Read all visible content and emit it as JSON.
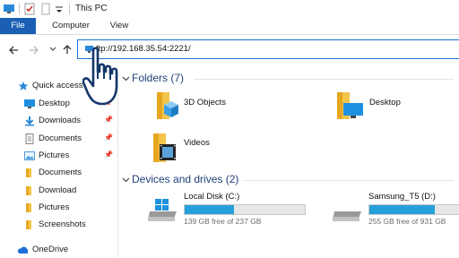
{
  "window": {
    "title": "This PC"
  },
  "ribbon": {
    "tabs": [
      "File",
      "Computer",
      "View"
    ]
  },
  "nav": {
    "back_icon": "back-arrow-icon",
    "forward_icon": "forward-arrow-icon",
    "recent_icon": "chevron-down-icon",
    "up_icon": "up-arrow-icon"
  },
  "address": {
    "value": "ftp://192.168.35.54:2221/"
  },
  "sidebar": {
    "items": [
      {
        "label": "Quick access",
        "icon": "star-icon",
        "pinned": false
      },
      {
        "label": "Desktop",
        "icon": "desktop-icon",
        "pinned": true
      },
      {
        "label": "Downloads",
        "icon": "download-icon",
        "pinned": true
      },
      {
        "label": "Documents",
        "icon": "documents-icon",
        "pinned": true
      },
      {
        "label": "Pictures",
        "icon": "pictures-icon",
        "pinned": true
      },
      {
        "label": "Documents",
        "icon": "folder-icon",
        "pinned": false
      },
      {
        "label": "Download",
        "icon": "folder-icon",
        "pinned": false
      },
      {
        "label": "Pictures",
        "icon": "folder-icon",
        "pinned": false
      },
      {
        "label": "Screenshots",
        "icon": "folder-icon",
        "pinned": false
      },
      {
        "label": "OneDrive",
        "icon": "cloud-icon",
        "pinned": false
      }
    ]
  },
  "folders": {
    "heading": "Folders (7)",
    "items": [
      {
        "name": "3D Objects",
        "icon": "3d-objects-folder-icon"
      },
      {
        "name": "Desktop",
        "icon": "desktop-folder-icon"
      },
      {
        "name": "Videos",
        "icon": "videos-folder-icon"
      }
    ]
  },
  "drives": {
    "heading": "Devices and drives (2)",
    "items": [
      {
        "name": "Local Disk (C:)",
        "free_text": "139 GB free of 237 GB",
        "used_fraction": 0.41,
        "icon": "windows-drive-icon"
      },
      {
        "name": "Samsung_T5 (D:)",
        "free_text": "255 GB free of 931 GB",
        "used_fraction": 0.73,
        "icon": "drive-icon"
      }
    ]
  },
  "colors": {
    "accent": "#1a5fb4",
    "usage_bar": "#26a0da",
    "group_title": "#1e3f7a"
  }
}
